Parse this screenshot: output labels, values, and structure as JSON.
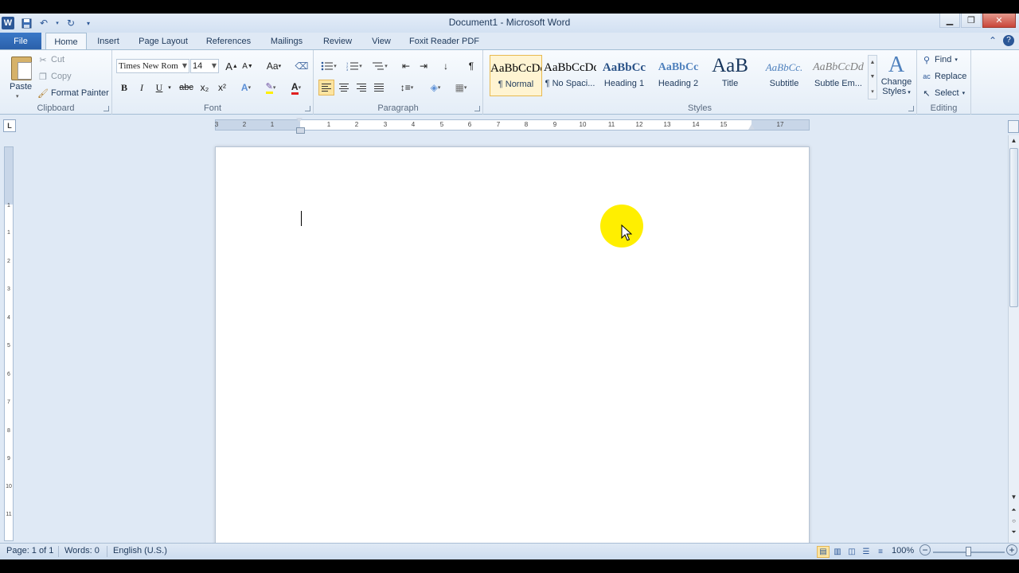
{
  "window": {
    "title": "Document1 - Microsoft Word",
    "app_icon_letter": "W"
  },
  "quick_access": [
    {
      "name": "save-icon",
      "glyph": "💾"
    },
    {
      "name": "undo-icon",
      "glyph": "↶"
    },
    {
      "name": "redo-icon",
      "glyph": "↻"
    },
    {
      "name": "customize-qat-icon",
      "glyph": "▾"
    }
  ],
  "ribbon_tabs": {
    "file": "File",
    "home": "Home",
    "insert": "Insert",
    "page_layout": "Page Layout",
    "references": "References",
    "mailings": "Mailings",
    "review": "Review",
    "view": "View",
    "foxit": "Foxit Reader PDF"
  },
  "clipboard": {
    "label": "Clipboard",
    "paste": "Paste",
    "cut": "Cut",
    "copy": "Copy",
    "format_painter": "Format Painter"
  },
  "font": {
    "label": "Font",
    "family": "Times New Rom",
    "size": "14",
    "grow": "A",
    "shrink": "A",
    "change_case": "Aa",
    "bold": "B",
    "italic": "I",
    "underline": "U",
    "strike": "abc",
    "subscript": "x₂",
    "superscript": "x²",
    "font_color": "A"
  },
  "paragraph": {
    "label": "Paragraph",
    "show_marks": "¶"
  },
  "styles": {
    "label": "Styles",
    "items": [
      {
        "sample": "AaBbCcDd",
        "name": "¶ Normal"
      },
      {
        "sample": "AaBbCcDd",
        "name": "¶ No Spaci..."
      },
      {
        "sample": "AaBbCc",
        "name": "Heading 1"
      },
      {
        "sample": "AaBbCc",
        "name": "Heading 2"
      },
      {
        "sample": "AaB",
        "name": "Title"
      },
      {
        "sample": "AaBbCc.",
        "name": "Subtitle"
      },
      {
        "sample": "AaBbCcDd",
        "name": "Subtle Em..."
      }
    ],
    "change_styles_line1": "Change",
    "change_styles_line2": "Styles"
  },
  "editing": {
    "label": "Editing",
    "find": "Find",
    "replace": "Replace",
    "select": "Select"
  },
  "ruler": {
    "tab_selector": "L",
    "numbers": [
      "3",
      "2",
      "1",
      "1",
      "2",
      "3",
      "4",
      "5",
      "6",
      "7",
      "8",
      "9",
      "10",
      "11",
      "12",
      "13",
      "14",
      "15",
      "17"
    ]
  },
  "vruler": {
    "numbers": [
      "1",
      "1",
      "2",
      "3",
      "4",
      "5",
      "6",
      "7",
      "8",
      "9",
      "10",
      "11"
    ]
  },
  "statusbar": {
    "page": "Page: 1 of 1",
    "words": "Words: 0",
    "language": "English (U.S.)",
    "zoom": "100%",
    "zoom_out": "−",
    "zoom_in": "+"
  },
  "colors": {
    "accent": "#2b5797",
    "file_tab": "#2a5fa8",
    "cursor_highlight": "#ffef00"
  }
}
